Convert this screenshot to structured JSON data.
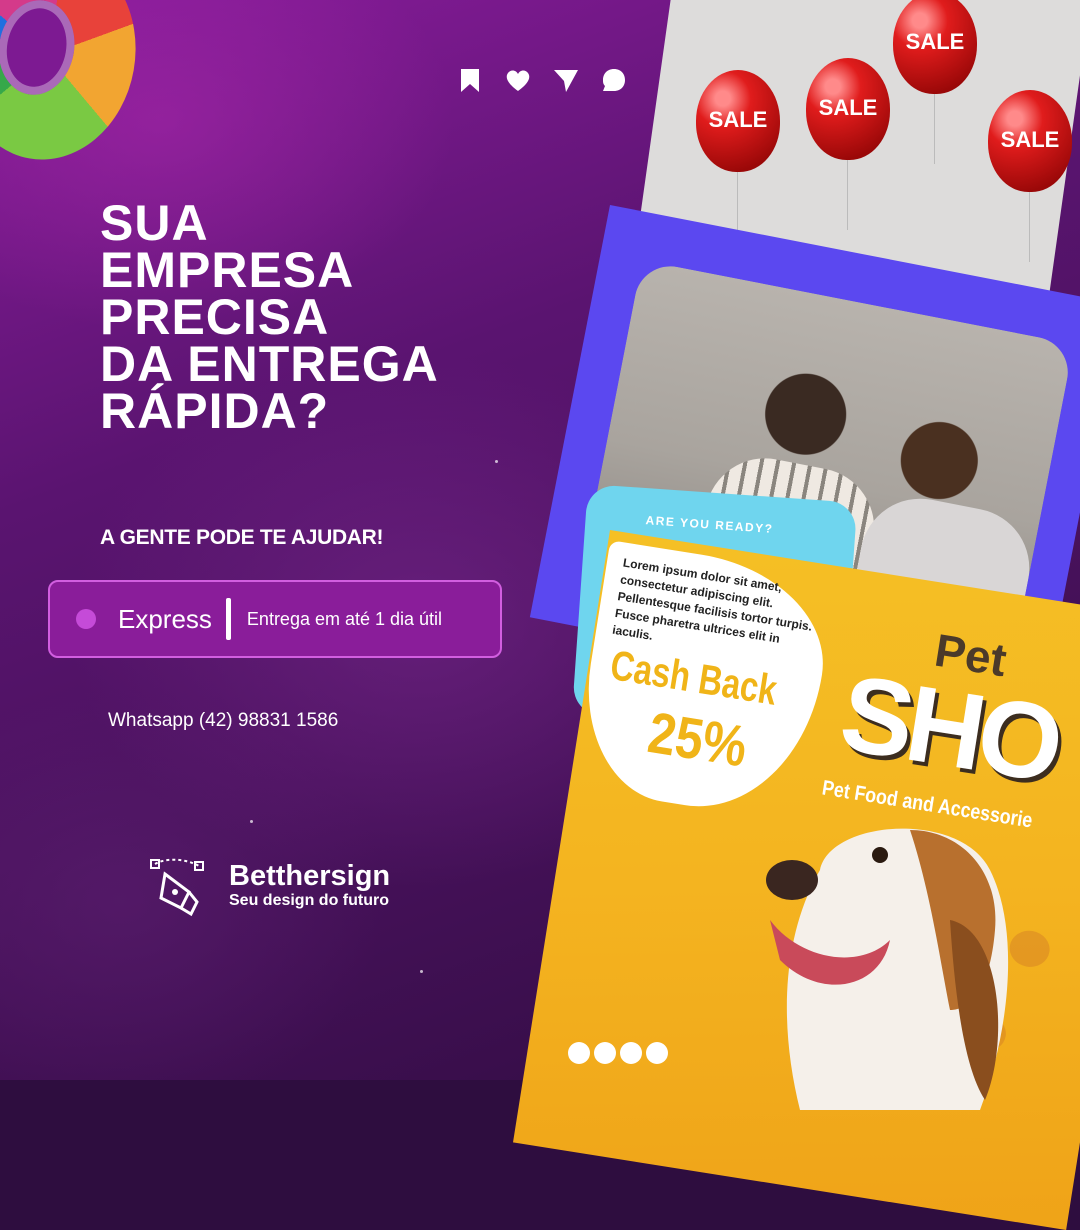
{
  "headline": {
    "lines": [
      "SUA",
      "EMPRESA",
      "PRECISA",
      "DA ENTREGA",
      "RÁPIDA?"
    ]
  },
  "subheadline": "A GENTE PODE TE AJUDAR!",
  "service": {
    "label": "Express",
    "description": "Entrega em até 1 dia útil"
  },
  "contact": {
    "whatsapp": "Whatsapp (42) 98831 1586"
  },
  "brand": {
    "name": "Betthersign",
    "tagline": "Seu design do futuro"
  },
  "social_icons": [
    "bookmark-icon",
    "heart-icon",
    "send-icon",
    "comment-icon"
  ],
  "collage": {
    "balloons": [
      "SALE",
      "SALE",
      "SALE",
      "SALE"
    ],
    "card_heading": "ARE YOU READY?",
    "lorem": "Lorem ipsum dolor sit amet, consectetur adipiscing elit. Pellentesque facilisis tortor turpis. Fusce pharetra ultrices elit in iaculis.",
    "cashback_label": "Cash Back",
    "cashback_value": "25%",
    "pet_label": "Pet",
    "shop_label": "SHO",
    "accessories": "Pet Food and Accessorie"
  },
  "colors": {
    "background": "#5a1470",
    "pill_bg": "#8a1d9a",
    "pill_border": "#d25ee0",
    "accent_dot": "#c54bd8",
    "orange": "#f5c025",
    "blue": "#5b48f0",
    "cyan": "#6fd5ee"
  }
}
